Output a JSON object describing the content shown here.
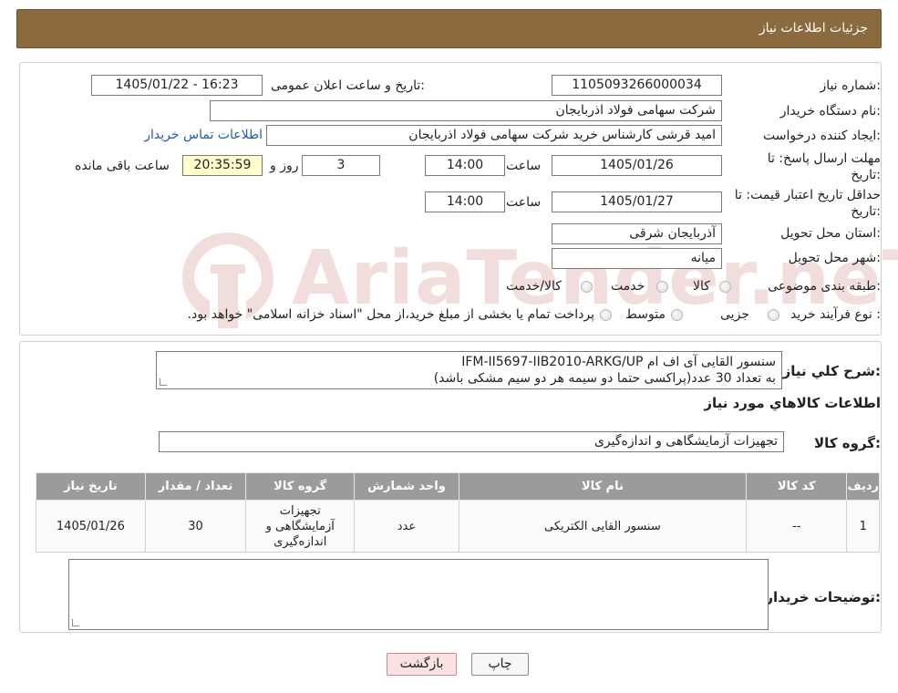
{
  "header": {
    "title": "جزئیات اطلاعات نیاز"
  },
  "form": {
    "need_number_label": "شماره نیاز:",
    "need_number": "1105093266000034",
    "announce_label": "تاریخ و ساعت اعلان عمومی:",
    "announce_value": "1405/01/22 - 16:23",
    "buyer_org_label": "نام دستگاه خریدار:",
    "buyer_org": "شرکت سهامی فولاد اذربایجان",
    "requester_label": "ایجاد کننده درخواست:",
    "requester": "امید قرشی کارشناس خرید شرکت سهامی فولاد اذربایجان",
    "contact_link": "اطلاعات تماس خریدار",
    "reply_deadline_label_1": "مهلت ارسال پاسخ: تا",
    "reply_deadline_label_2": "تاریخ:",
    "reply_date": "1405/01/26",
    "time_label": "ساعت",
    "reply_time": "14:00",
    "days_value": "3",
    "days_label": "روز و",
    "remaining_time": "20:35:59",
    "remaining_label": "ساعت باقی مانده",
    "validity_label_1": "حداقل تاریخ اعتبار قیمت: تا",
    "validity_label_2": "تاریخ:",
    "validity_date": "1405/01/27",
    "validity_time": "14:00",
    "province_label": "استان محل تحویل:",
    "province": "آذربایجان شرقی",
    "city_label": "شهر محل تحویل:",
    "city": "میانه",
    "category_label": "طبقه بندی موضوعی:",
    "category_options": [
      "کالا",
      "خدمت",
      "کالا/خدمت"
    ],
    "process_label": "نوع فرآیند خرید :",
    "process_options": [
      "جزیی",
      "متوسط"
    ],
    "process_note": "پرداخت تمام یا بخشی از مبلغ خرید،از محل \"اسناد خزانه اسلامی\" خواهد بود."
  },
  "watermark": {
    "text": "AriaTender.neT"
  },
  "description": {
    "label": "شرح کلي نياز:",
    "line1": "سنسور القایی آی اف ام IFM-II5697-IIB2010-ARKG/UP",
    "line2": "به تعداد 30 عدد(پراکسی حتما دو سیمه هر دو سیم مشکی باشد)"
  },
  "goods_info_title": "اطلاعات کالاهاي مورد نياز",
  "goods_group": {
    "label": "گروه کالا:",
    "value": "تجهیزات آزمایشگاهی و اندازه‌گیری"
  },
  "table": {
    "headers": [
      "ردیف",
      "کد کالا",
      "نام کالا",
      "واحد شمارش",
      "گروه کالا",
      "تعداد / مقدار",
      "تاریخ نیاز"
    ],
    "rows": [
      [
        "1",
        "--",
        "سنسور القایی الکتریکی",
        "عدد",
        "تجهیزات آزمایشگاهی و اندازه‌گیری",
        "30",
        "1405/01/26"
      ]
    ]
  },
  "buyer_notes_label": "توضیحات خریدار:",
  "buttons": {
    "print": "چاپ",
    "back": "بازگشت"
  }
}
